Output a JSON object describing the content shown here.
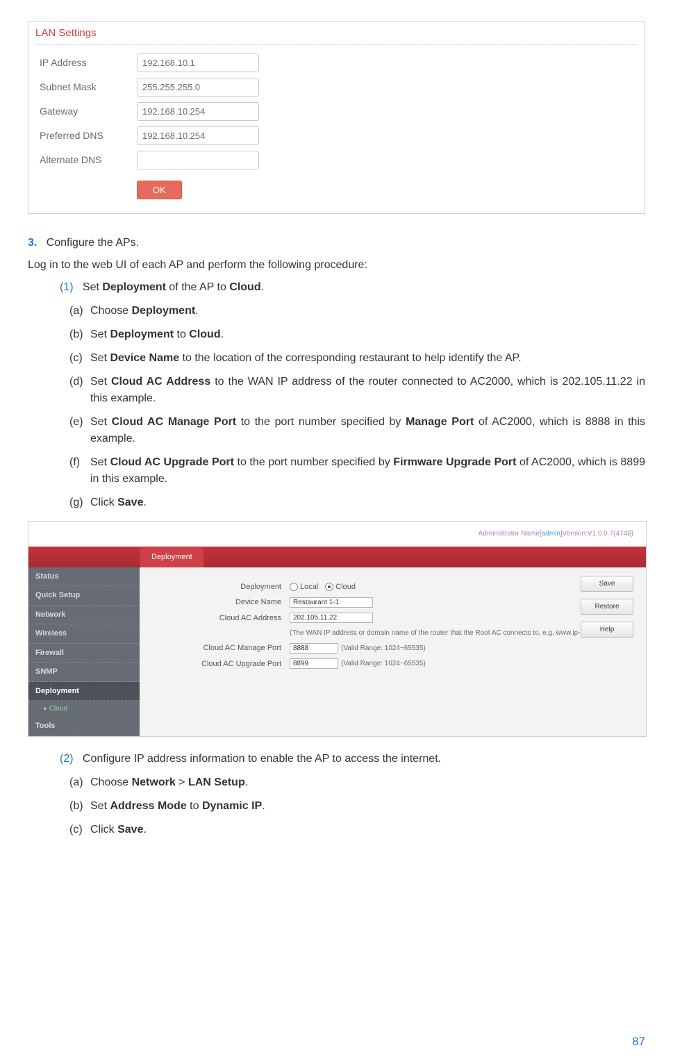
{
  "fig1": {
    "title": "LAN Settings",
    "rows": [
      {
        "label": "IP Address",
        "value": "192.168.10.1"
      },
      {
        "label": "Subnet Mask",
        "value": "255.255.255.0"
      },
      {
        "label": "Gateway",
        "value": "192.168.10.254"
      },
      {
        "label": "Preferred DNS",
        "value": "192.168.10.254"
      },
      {
        "label": "Alternate DNS",
        "value": ""
      }
    ],
    "ok": "OK"
  },
  "step3": {
    "num": "3.",
    "title": "Configure the APs.",
    "intro": "Log in to the web UI of each AP and perform the following procedure:",
    "sub1": {
      "num": "(1)",
      "txt_pre": "Set ",
      "b1": "Deployment",
      "txt_mid": " of the AP to ",
      "b2": "Cloud",
      "txt_end": "."
    },
    "list1": {
      "a": {
        "l": "(a)",
        "pre": "Choose ",
        "b1": "Deployment",
        "end": "."
      },
      "b": {
        "l": "(b)",
        "pre": "Set ",
        "b1": "Deployment",
        "mid": " to ",
        "b2": "Cloud",
        "end": "."
      },
      "c": {
        "l": "(c)",
        "pre": "Set ",
        "b1": "Device Name",
        "end": " to the location of the corresponding restaurant to help identify the AP."
      },
      "d": {
        "l": "(d)",
        "pre": "Set ",
        "b1": "Cloud AC Address",
        "end": " to the WAN IP address of the router connected to AC2000, which is 202.105.11.22 in this example."
      },
      "e": {
        "l": "(e)",
        "pre": "Set ",
        "b1": "Cloud AC Manage Port",
        "mid": " to the port number specified by ",
        "b2": "Manage Port",
        "end": " of AC2000, which is 8888 in this example."
      },
      "f": {
        "l": "(f)",
        "pre": "Set ",
        "b1": "Cloud AC Upgrade Port",
        "mid": " to the port number specified by ",
        "b2": "Firmware Upgrade Port",
        "end": " of AC2000, which is 8899 in this example."
      },
      "g": {
        "l": "(g)",
        "pre": "Click ",
        "b1": "Save",
        "end": "."
      }
    }
  },
  "fig2": {
    "top": {
      "label": "Administrator Name[",
      "admin": "admin",
      "ver": "]Version:V1.0.0.7(4748)"
    },
    "tab": "Deployment",
    "nav": {
      "status": "Status",
      "quick": "Quick Setup",
      "network": "Network",
      "wireless": "Wireless",
      "firewall": "Firewall",
      "snmp": "SNMP",
      "deployment": "Deployment",
      "cloud": "Cloud",
      "tools": "Tools"
    },
    "form": {
      "deployment": {
        "label": "Deployment",
        "opt_local": "Local",
        "opt_cloud": "Cloud"
      },
      "device": {
        "label": "Device Name",
        "value": "Restaurant 1-1"
      },
      "addr": {
        "label": "Cloud AC Address",
        "value": "202.105.11.22"
      },
      "hint": "(The WAN IP address or domain name of the router that the Root AC connects to, e.g. www.ip-com.com.cn)",
      "manage": {
        "label": "Cloud AC Manage Port",
        "value": "8888",
        "note": "(Valid Range: 1024~65535)"
      },
      "upgrade": {
        "label": "Cloud AC Upgrade Port",
        "value": "8899",
        "note": "(Valid Range: 1024~65535)"
      }
    },
    "buttons": {
      "save": "Save",
      "restore": "Restore",
      "help": "Help"
    }
  },
  "step3b": {
    "sub2": {
      "num": "(2)",
      "txt": "Configure IP address information to enable the AP to access the internet."
    },
    "list2": {
      "a": {
        "l": "(a)",
        "pre": "Choose ",
        "b1": "Network",
        "mid": " > ",
        "b2": "LAN Setup",
        "end": "."
      },
      "b": {
        "l": "(b)",
        "pre": "Set ",
        "b1": "Address Mode",
        "mid": " to ",
        "b2": "Dynamic IP",
        "end": "."
      },
      "c": {
        "l": "(c)",
        "pre": "Click ",
        "b1": "Save",
        "end": "."
      }
    }
  },
  "page": "87"
}
